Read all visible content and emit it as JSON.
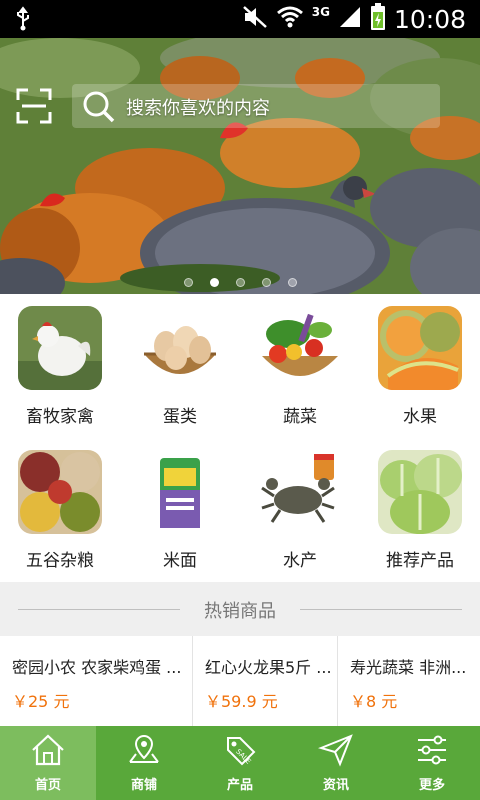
{
  "status_bar": {
    "time": "10:08",
    "network": "3G",
    "icons": [
      "usb-icon",
      "mute-icon",
      "wifi-icon",
      "signal-icon",
      "battery-charging-icon"
    ]
  },
  "search": {
    "placeholder": "搜索你喜欢的内容",
    "scan_icon": "scan-icon",
    "search_icon": "search-icon"
  },
  "banner": {
    "slides": 5,
    "active_slide": 2
  },
  "categories": [
    {
      "label": "畜牧家禽",
      "icon": "chicken-image"
    },
    {
      "label": "蛋类",
      "icon": "eggs-image"
    },
    {
      "label": "蔬菜",
      "icon": "vegetables-image"
    },
    {
      "label": "水果",
      "icon": "melon-image"
    },
    {
      "label": "五谷杂粮",
      "icon": "grains-image"
    },
    {
      "label": "米面",
      "icon": "rice-bag-image"
    },
    {
      "label": "水产",
      "icon": "crab-image"
    },
    {
      "label": "推荐产品",
      "icon": "cabbage-image"
    }
  ],
  "section": {
    "title": "热销商品"
  },
  "products": [
    {
      "name": "密园小农 农家柴鸡蛋 ...",
      "price": "￥25 元"
    },
    {
      "name": "红心火龙果5斤 ...",
      "price": "￥59.9 元"
    },
    {
      "name": "寿光蔬菜 非洲...",
      "price": "￥8 元"
    }
  ],
  "bottom_nav": [
    {
      "label": "首页",
      "icon": "home-icon",
      "active": true
    },
    {
      "label": "商铺",
      "icon": "map-pin-icon",
      "active": false
    },
    {
      "label": "产品",
      "icon": "sale-tag-icon",
      "active": false
    },
    {
      "label": "资讯",
      "icon": "send-icon",
      "active": false
    },
    {
      "label": "更多",
      "icon": "sliders-icon",
      "active": false
    }
  ],
  "colors": {
    "nav_background": "#59a83a",
    "nav_active": "#7dbd5e",
    "price": "#f0720c",
    "status_bar": "#000000"
  }
}
